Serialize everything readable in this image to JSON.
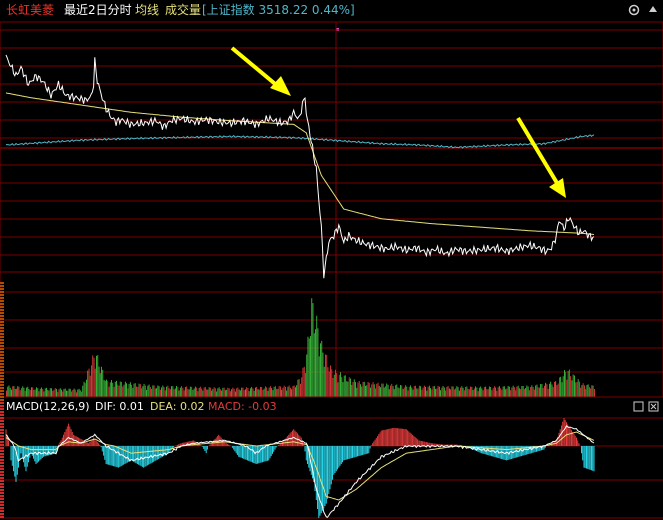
{
  "header": {
    "stock_name": "长虹美菱",
    "period_label": "最近2日分时",
    "avg_label": "均线",
    "volume_label": "成交量",
    "index_text": "[上证指数 3518.22 0.44%]",
    "settings_icon": "gear-icon",
    "collapse_icon": "up-triangle-icon"
  },
  "macd_header": {
    "name": "MACD(12,26,9)",
    "dif_text": "DIF: 0.01",
    "dea_text": "DEA: 0.02",
    "macd_text": "MACD: -0.03",
    "window_icons": [
      "minimize-icon",
      "close-icon"
    ]
  },
  "colors": {
    "background": "#000000",
    "grid_red": "#7a0000",
    "stock_name": "#e8342a",
    "price_line": "#ffffff",
    "avg_line": "#e6e07a",
    "index_line": "#4fb6c9",
    "vol_up": "#e23b3b",
    "vol_down": "#3cbf3c",
    "macd_pos": "#e23b3b",
    "macd_neg": "#29d3e6",
    "dif_line": "#ffffff",
    "dea_line": "#e6e07a",
    "annotation_arrow": "#ffff00"
  },
  "chart_data": {
    "type": "line",
    "sessions": 2,
    "minutes_per_session": 240,
    "annotations": [
      {
        "type": "arrow",
        "target_minute": 71,
        "note": "spike near end of session 1"
      },
      {
        "type": "arrow",
        "target_minute": 450,
        "note": "spike near end of session 2"
      }
    ],
    "price_keyframes": [
      [
        0,
        0.78
      ],
      [
        4,
        0.7
      ],
      [
        8,
        0.62
      ],
      [
        12,
        0.69
      ],
      [
        18,
        0.55
      ],
      [
        24,
        0.62
      ],
      [
        30,
        0.57
      ],
      [
        36,
        0.46
      ],
      [
        42,
        0.55
      ],
      [
        48,
        0.46
      ],
      [
        56,
        0.44
      ],
      [
        64,
        0.42
      ],
      [
        68,
        0.45
      ],
      [
        70,
        0.55
      ],
      [
        71,
        0.74
      ],
      [
        73,
        0.58
      ],
      [
        76,
        0.47
      ],
      [
        80,
        0.35
      ],
      [
        84,
        0.28
      ],
      [
        88,
        0.24
      ],
      [
        92,
        0.26
      ],
      [
        100,
        0.22
      ],
      [
        110,
        0.23
      ],
      [
        120,
        0.25
      ],
      [
        126,
        0.2
      ],
      [
        132,
        0.25
      ],
      [
        140,
        0.27
      ],
      [
        150,
        0.24
      ],
      [
        160,
        0.26
      ],
      [
        170,
        0.24
      ],
      [
        180,
        0.23
      ],
      [
        190,
        0.25
      ],
      [
        200,
        0.22
      ],
      [
        210,
        0.27
      ],
      [
        220,
        0.23
      ],
      [
        226,
        0.25
      ],
      [
        230,
        0.32
      ],
      [
        234,
        0.26
      ],
      [
        239,
        0.46
      ],
      [
        240,
        0.3
      ],
      [
        242,
        0.2
      ],
      [
        244,
        0.08
      ],
      [
        246,
        -0.04
      ],
      [
        248,
        -0.15
      ],
      [
        250,
        -0.4
      ],
      [
        252,
        -0.62
      ],
      [
        254,
        -1.02
      ],
      [
        256,
        -0.9
      ],
      [
        258,
        -0.75
      ],
      [
        262,
        -0.7
      ],
      [
        266,
        -0.62
      ],
      [
        270,
        -0.75
      ],
      [
        274,
        -0.7
      ],
      [
        280,
        -0.74
      ],
      [
        288,
        -0.77
      ],
      [
        296,
        -0.79
      ],
      [
        304,
        -0.81
      ],
      [
        312,
        -0.79
      ],
      [
        320,
        -0.82
      ],
      [
        328,
        -0.8
      ],
      [
        336,
        -0.84
      ],
      [
        344,
        -0.81
      ],
      [
        352,
        -0.85
      ],
      [
        360,
        -0.81
      ],
      [
        368,
        -0.83
      ],
      [
        376,
        -0.82
      ],
      [
        384,
        -0.81
      ],
      [
        392,
        -0.8
      ],
      [
        400,
        -0.83
      ],
      [
        410,
        -0.8
      ],
      [
        418,
        -0.78
      ],
      [
        426,
        -0.8
      ],
      [
        432,
        -0.83
      ],
      [
        436,
        -0.8
      ],
      [
        440,
        -0.7
      ],
      [
        442,
        -0.57
      ],
      [
        446,
        -0.64
      ],
      [
        450,
        -0.55
      ],
      [
        454,
        -0.62
      ],
      [
        458,
        -0.68
      ],
      [
        462,
        -0.66
      ],
      [
        466,
        -0.7
      ],
      [
        470,
        -0.72
      ]
    ],
    "avg_keyframes": [
      [
        0,
        0.48
      ],
      [
        20,
        0.44
      ],
      [
        60,
        0.38
      ],
      [
        100,
        0.32
      ],
      [
        140,
        0.28
      ],
      [
        180,
        0.25
      ],
      [
        230,
        0.22
      ],
      [
        240,
        0.15
      ],
      [
        252,
        -0.2
      ],
      [
        270,
        -0.48
      ],
      [
        300,
        -0.56
      ],
      [
        340,
        -0.6
      ],
      [
        380,
        -0.63
      ],
      [
        420,
        -0.66
      ],
      [
        460,
        -0.68
      ],
      [
        470,
        -0.69
      ]
    ],
    "index_keyframes": [
      [
        0,
        0.05
      ],
      [
        30,
        0.07
      ],
      [
        60,
        0.09
      ],
      [
        90,
        0.1
      ],
      [
        130,
        0.11
      ],
      [
        180,
        0.12
      ],
      [
        230,
        0.11
      ],
      [
        260,
        0.09
      ],
      [
        300,
        0.06
      ],
      [
        330,
        0.05
      ],
      [
        360,
        0.03
      ],
      [
        400,
        0.05
      ],
      [
        430,
        0.06
      ],
      [
        460,
        0.12
      ],
      [
        470,
        0.13
      ]
    ],
    "volume_keyframes": [
      [
        0,
        0.1
      ],
      [
        30,
        0.08
      ],
      [
        60,
        0.07
      ],
      [
        71,
        0.42
      ],
      [
        80,
        0.15
      ],
      [
        120,
        0.1
      ],
      [
        180,
        0.08
      ],
      [
        230,
        0.1
      ],
      [
        236,
        0.2
      ],
      [
        240,
        0.4
      ],
      [
        244,
        0.88
      ],
      [
        248,
        0.7
      ],
      [
        252,
        0.48
      ],
      [
        260,
        0.25
      ],
      [
        280,
        0.14
      ],
      [
        320,
        0.1
      ],
      [
        380,
        0.09
      ],
      [
        420,
        0.1
      ],
      [
        440,
        0.14
      ],
      [
        448,
        0.26
      ],
      [
        460,
        0.12
      ],
      [
        470,
        0.1
      ]
    ],
    "macd_hist_keyframes": [
      [
        0,
        0.6
      ],
      [
        4,
        -0.2
      ],
      [
        8,
        -0.5
      ],
      [
        12,
        -0.1
      ],
      [
        16,
        -0.35
      ],
      [
        20,
        -0.1
      ],
      [
        24,
        -0.25
      ],
      [
        30,
        -0.15
      ],
      [
        40,
        -0.1
      ],
      [
        44,
        0.2
      ],
      [
        50,
        0.8
      ],
      [
        54,
        0.4
      ],
      [
        58,
        0.3
      ],
      [
        66,
        0.1
      ],
      [
        70,
        0.3
      ],
      [
        74,
        0.1
      ],
      [
        80,
        -0.25
      ],
      [
        90,
        -0.3
      ],
      [
        100,
        -0.2
      ],
      [
        110,
        -0.3
      ],
      [
        120,
        -0.2
      ],
      [
        130,
        -0.1
      ],
      [
        140,
        0.1
      ],
      [
        150,
        0.2
      ],
      [
        160,
        -0.1
      ],
      [
        170,
        0.4
      ],
      [
        176,
        0.1
      ],
      [
        186,
        -0.15
      ],
      [
        200,
        -0.25
      ],
      [
        210,
        -0.2
      ],
      [
        220,
        0.1
      ],
      [
        230,
        0.6
      ],
      [
        236,
        0.3
      ],
      [
        240,
        -0.2
      ],
      [
        246,
        -0.5
      ],
      [
        250,
        -1.0
      ],
      [
        256,
        -0.8
      ],
      [
        262,
        -0.4
      ],
      [
        270,
        -0.2
      ],
      [
        290,
        -0.1
      ],
      [
        300,
        0.55
      ],
      [
        310,
        0.65
      ],
      [
        320,
        0.6
      ],
      [
        330,
        0.2
      ],
      [
        340,
        0.1
      ],
      [
        350,
        0.05
      ],
      [
        360,
        0.05
      ],
      [
        380,
        -0.1
      ],
      [
        400,
        -0.2
      ],
      [
        420,
        -0.1
      ],
      [
        430,
        -0.05
      ],
      [
        440,
        0.2
      ],
      [
        446,
        1.0
      ],
      [
        450,
        0.7
      ],
      [
        456,
        0.3
      ],
      [
        462,
        -0.3
      ],
      [
        470,
        -0.35
      ]
    ],
    "macd_dif_keyframes": [
      [
        0,
        0.4
      ],
      [
        10,
        -0.2
      ],
      [
        20,
        -0.1
      ],
      [
        40,
        -0.1
      ],
      [
        50,
        0.3
      ],
      [
        60,
        0.1
      ],
      [
        71,
        0.4
      ],
      [
        80,
        0.0
      ],
      [
        100,
        -0.2
      ],
      [
        130,
        -0.1
      ],
      [
        150,
        0.1
      ],
      [
        175,
        0.2
      ],
      [
        200,
        -0.1
      ],
      [
        230,
        0.3
      ],
      [
        240,
        0.1
      ],
      [
        248,
        -0.6
      ],
      [
        256,
        -1.0
      ],
      [
        266,
        -0.8
      ],
      [
        280,
        -0.5
      ],
      [
        300,
        -0.15
      ],
      [
        320,
        0.0
      ],
      [
        360,
        0.0
      ],
      [
        400,
        -0.1
      ],
      [
        430,
        0.0
      ],
      [
        440,
        0.2
      ],
      [
        448,
        0.7
      ],
      [
        456,
        0.6
      ],
      [
        470,
        0.1
      ]
    ],
    "macd_dea_keyframes": [
      [
        0,
        0.3
      ],
      [
        10,
        0.0
      ],
      [
        20,
        -0.05
      ],
      [
        40,
        -0.05
      ],
      [
        50,
        0.15
      ],
      [
        60,
        0.1
      ],
      [
        71,
        0.25
      ],
      [
        80,
        0.05
      ],
      [
        100,
        -0.1
      ],
      [
        130,
        -0.05
      ],
      [
        150,
        0.05
      ],
      [
        175,
        0.15
      ],
      [
        200,
        0.0
      ],
      [
        230,
        0.15
      ],
      [
        240,
        0.05
      ],
      [
        248,
        -0.3
      ],
      [
        256,
        -0.7
      ],
      [
        266,
        -0.75
      ],
      [
        280,
        -0.6
      ],
      [
        300,
        -0.3
      ],
      [
        320,
        -0.1
      ],
      [
        360,
        0.0
      ],
      [
        400,
        -0.05
      ],
      [
        430,
        0.0
      ],
      [
        440,
        0.1
      ],
      [
        448,
        0.4
      ],
      [
        456,
        0.5
      ],
      [
        470,
        0.2
      ]
    ]
  }
}
